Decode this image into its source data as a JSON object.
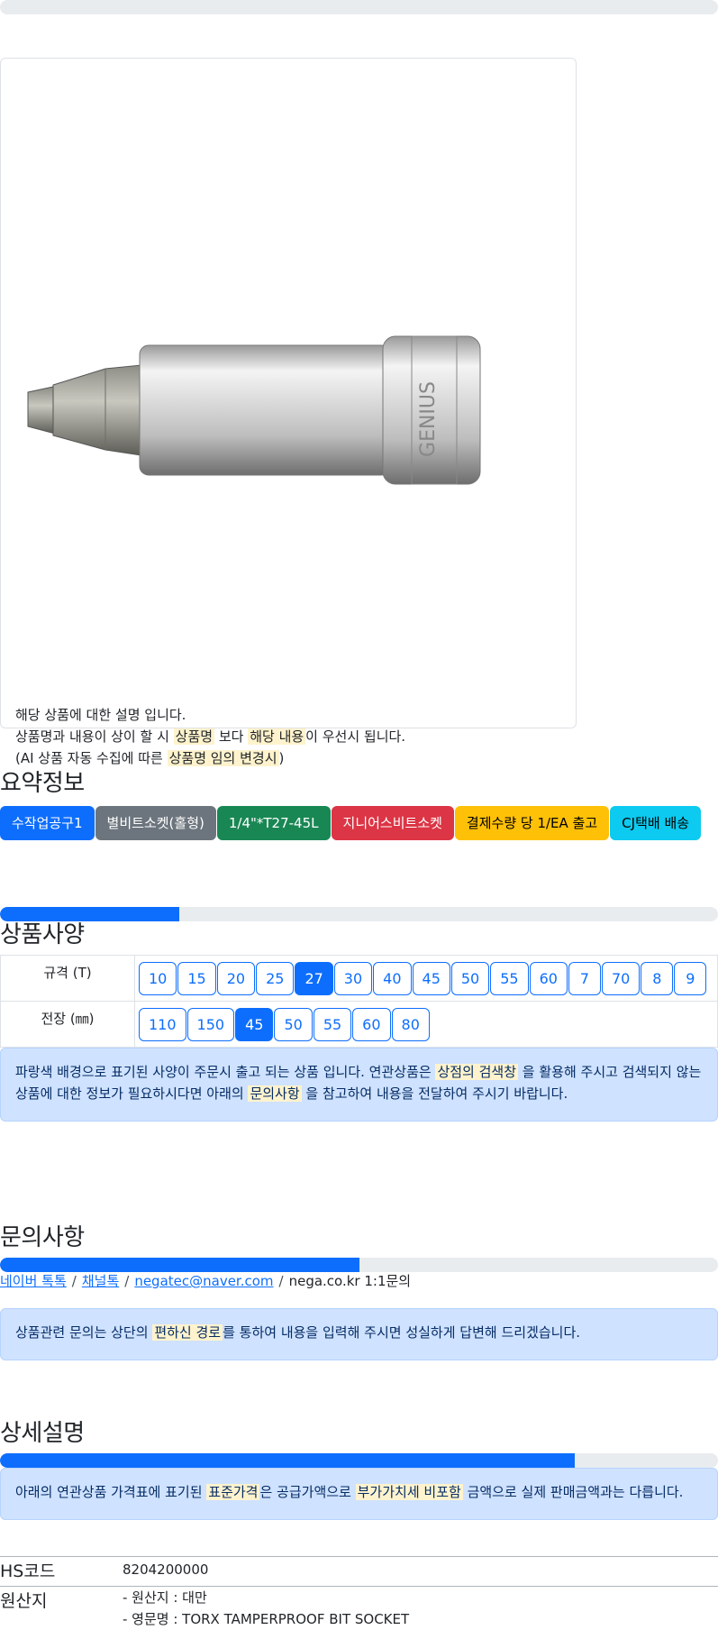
{
  "image_card": {
    "description_lines": {
      "line1": "해당 상품에 대한 설명 입니다.",
      "line2_pre": "상품명과 내용이 상이 할 시 ",
      "line2_hl1": "상품명",
      "line2_mid": " 보다 ",
      "line2_hl2": "해당 내용",
      "line2_post": "이 우선시 됩니다.",
      "line3_pre": "(AI 상품 자동 수집에 따른 ",
      "line3_hl": "상품명 임의 변경시",
      "line3_post": ")"
    }
  },
  "summary": {
    "title": "요약정보",
    "badges": [
      {
        "label": "수작업공구1",
        "color": "#0d6efd"
      },
      {
        "label": "별비트소켓(홀형)",
        "color": "#6c757d"
      },
      {
        "label": "1/4\"*T27-45L",
        "color": "#198754"
      },
      {
        "label": "지니어스비트소켓",
        "color": "#dc3545"
      },
      {
        "label": "결제수량 당 1/EA 출고",
        "color": "#ffc107"
      },
      {
        "label": "CJ택배 배송",
        "color": "#0dcaf0"
      }
    ]
  },
  "specs": {
    "title": "상품사양",
    "progress_percent": 25,
    "rows": [
      {
        "label": "규격 (T)",
        "options": [
          "10",
          "15",
          "20",
          "25",
          "27",
          "30",
          "40",
          "45",
          "50",
          "55",
          "60",
          "7",
          "70",
          "8",
          "9"
        ],
        "selected": "27"
      },
      {
        "label": "전장 (㎜)",
        "options": [
          "110",
          "150",
          "45",
          "50",
          "55",
          "60",
          "80"
        ],
        "selected": "45"
      }
    ],
    "notice": {
      "pre": "파랑색 배경으로 표기된 사양이 주문시 출고 되는 상품 입니다. 연관상품은 ",
      "hl1": "상점의 검색창",
      "mid": " 을 활용해 주시고 검색되지 않는 상품에 대한 정보가 필요하시다면 아래의 ",
      "hl2": "문의사항",
      "post": " 을 참고하여 내용을 전달하여 주시기 바랍니다."
    }
  },
  "inquiry": {
    "title": "문의사항",
    "progress_percent": 50,
    "links": [
      "네이버 톡톡",
      "채널톡",
      "negatec@naver.com"
    ],
    "separator": "/",
    "last": "nega.co.kr 1:1문의",
    "notice": {
      "pre": "상품관련 문의는 상단의 ",
      "hl": "편하신 경로",
      "post": "를 통하여 내용을 입력해 주시면 성실하게 답변해 드리겠습니다."
    }
  },
  "detail": {
    "title": "상세설명",
    "progress_percent": 80,
    "notice": {
      "pre": "아래의 연관상품 가격표에 표기된 ",
      "hl1": "표준가격",
      "mid": "은 공급가액으로 ",
      "hl2": "부가가치세 비포함",
      "post": " 금액으로 실제 판매금액과는 다릅니다."
    }
  },
  "info": {
    "hs_label": "HS코드",
    "hs_value": "8204200000",
    "origin_label": "원산지",
    "origin_line1": "- 원산지 : 대만",
    "origin_line2": "- 영문명 : TORX TAMPERPROOF BIT SOCKET"
  },
  "colors": {
    "primary": "#0d6efd",
    "highlight": "#fff3cd",
    "alert_bg": "#cfe2ff"
  }
}
